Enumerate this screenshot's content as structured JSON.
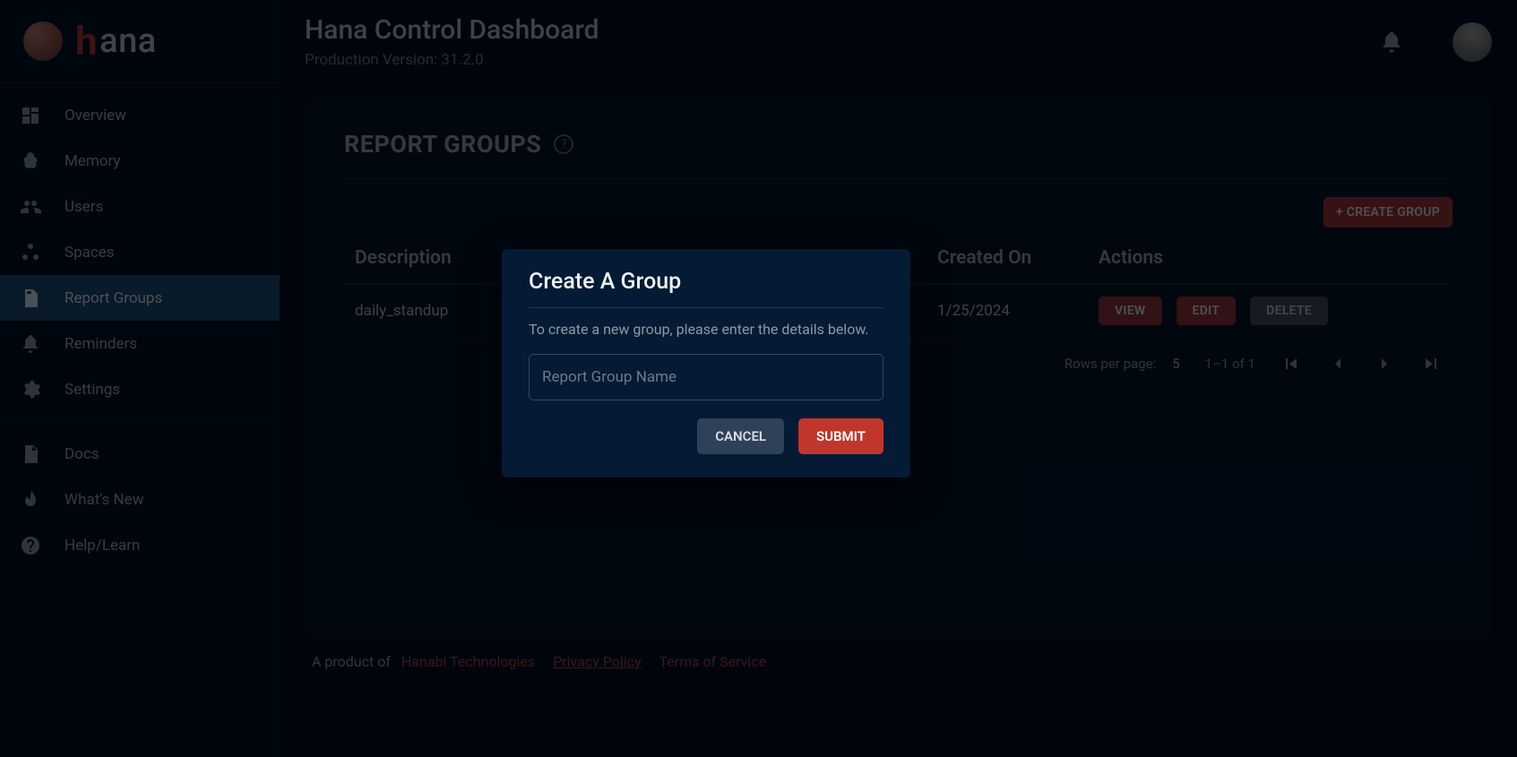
{
  "brand": {
    "name": "ana",
    "accent": "h"
  },
  "header": {
    "title": "Hana Control Dashboard",
    "subtitle": "Production Version: 31.2.0"
  },
  "sidebar": {
    "items": [
      {
        "label": "Overview",
        "icon": "dashboard-icon"
      },
      {
        "label": "Memory",
        "icon": "memory-icon"
      },
      {
        "label": "Users",
        "icon": "users-icon"
      },
      {
        "label": "Spaces",
        "icon": "spaces-icon"
      },
      {
        "label": "Report Groups",
        "icon": "report-groups-icon",
        "active": true
      },
      {
        "label": "Reminders",
        "icon": "reminders-icon"
      },
      {
        "label": "Settings",
        "icon": "settings-icon"
      }
    ],
    "secondary": [
      {
        "label": "Docs",
        "icon": "docs-icon"
      },
      {
        "label": "What's New",
        "icon": "whatsnew-icon"
      },
      {
        "label": "Help/Learn",
        "icon": "help-icon"
      }
    ]
  },
  "page": {
    "title": "REPORT GROUPS",
    "create_button": "+ CREATE GROUP",
    "columns": {
      "description": "Description",
      "created": "Created On",
      "actions": "Actions"
    },
    "rows": [
      {
        "description": "daily_standup",
        "created": "1/25/2024"
      }
    ],
    "row_actions": {
      "view": "VIEW",
      "edit": "EDIT",
      "delete": "DELETE"
    },
    "pagination": {
      "rows_label": "Rows per page:",
      "rows_value": "5",
      "range": "1–1 of 1"
    }
  },
  "modal": {
    "title": "Create A Group",
    "description": "To create a new group, please enter the details below.",
    "placeholder": "Report Group Name",
    "cancel": "CANCEL",
    "submit": "SUBMIT"
  },
  "footer": {
    "prefix": "A product of ",
    "company": "Hanabi Technologies",
    "privacy": "Privacy Policy",
    "terms": "Terms of Service"
  }
}
